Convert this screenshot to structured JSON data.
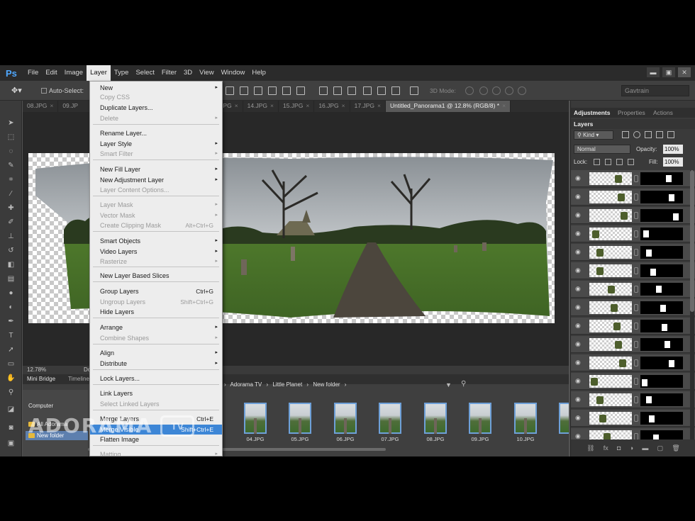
{
  "app": {
    "logo": "Ps"
  },
  "menubar": {
    "items": [
      "File",
      "Edit",
      "Image",
      "Layer",
      "Type",
      "Select",
      "Filter",
      "3D",
      "View",
      "Window",
      "Help"
    ],
    "active": "Layer"
  },
  "window_controls": {
    "minimize": "▬",
    "restore": "▣",
    "close": "✕"
  },
  "optionsbar": {
    "move_icon": "move-tool-icon",
    "auto_select_label": "Auto-Select:",
    "mode_3d_label": "3D Mode:",
    "workspace": "Gavtrain"
  },
  "doc_tabs": [
    {
      "label": "08.JPG"
    },
    {
      "label": "09.JP"
    },
    {
      "label": "13.JPG"
    },
    {
      "label": "14.JPG"
    },
    {
      "label": "15.JPG"
    },
    {
      "label": "16.JPG"
    },
    {
      "label": "17.JPG"
    },
    {
      "label": "Untitled_Panorama1 @ 12.8% (RGB/8) *"
    }
  ],
  "status": {
    "zoom": "12.78%",
    "doc_label": "Do"
  },
  "layer_menu": {
    "items": [
      {
        "label": "New",
        "disabled": false,
        "arrow": "▸"
      },
      {
        "label": "Copy CSS",
        "disabled": true
      },
      {
        "label": "Duplicate Layers...",
        "disabled": false
      },
      {
        "label": "Delete",
        "disabled": true,
        "arrow": "▸"
      },
      {
        "label": "Rename Layer...",
        "disabled": false
      },
      {
        "label": "Layer Style",
        "disabled": false,
        "arrow": "▸"
      },
      {
        "label": "Smart Filter",
        "disabled": true,
        "arrow": "▸"
      },
      {
        "label": "New Fill Layer",
        "disabled": false,
        "arrow": "▸"
      },
      {
        "label": "New Adjustment Layer",
        "disabled": false,
        "arrow": "▸"
      },
      {
        "label": "Layer Content Options...",
        "disabled": true
      },
      {
        "label": "Layer Mask",
        "disabled": true,
        "arrow": "▸"
      },
      {
        "label": "Vector Mask",
        "disabled": true,
        "arrow": "▸"
      },
      {
        "label": "Create Clipping Mask",
        "disabled": true,
        "shortcut": "Alt+Ctrl+G"
      },
      {
        "label": "Smart Objects",
        "disabled": false,
        "arrow": "▸"
      },
      {
        "label": "Video Layers",
        "disabled": false,
        "arrow": "▸"
      },
      {
        "label": "Rasterize",
        "disabled": true,
        "arrow": "▸"
      },
      {
        "label": "New Layer Based Slices",
        "disabled": false
      },
      {
        "label": "Group Layers",
        "disabled": false,
        "shortcut": "Ctrl+G"
      },
      {
        "label": "Ungroup Layers",
        "disabled": true,
        "shortcut": "Shift+Ctrl+G"
      },
      {
        "label": "Hide Layers",
        "disabled": false
      },
      {
        "label": "Arrange",
        "disabled": false,
        "arrow": "▸"
      },
      {
        "label": "Combine Shapes",
        "disabled": true,
        "arrow": "▸"
      },
      {
        "label": "Align",
        "disabled": false,
        "arrow": "▸"
      },
      {
        "label": "Distribute",
        "disabled": false,
        "arrow": "▸"
      },
      {
        "label": "Lock Layers...",
        "disabled": false
      },
      {
        "label": "Link Layers",
        "disabled": false
      },
      {
        "label": "Select Linked Layers",
        "disabled": true
      },
      {
        "label": "Merge Layers",
        "disabled": false,
        "shortcut": "Ctrl+E"
      },
      {
        "label": "Merge Visible",
        "disabled": false,
        "shortcut": "Shift+Ctrl+E",
        "highlighted": true
      },
      {
        "label": "Flatten Image",
        "disabled": false
      },
      {
        "label": "Matting",
        "disabled": true,
        "arrow": "▸"
      }
    ]
  },
  "mini_bridge": {
    "tabs": [
      "Mini Bridge",
      "Timeline"
    ],
    "nav_root": "Computer",
    "folders": [
      {
        "label": "All Adorama"
      },
      {
        "label": "New folder",
        "selected": true
      }
    ],
    "path": [
      "Adorama TV",
      "Little Planet",
      "New folder"
    ],
    "thumbs": [
      "04.JPG",
      "05.JPG",
      "06.JPG",
      "07.JPG",
      "08.JPG",
      "09.JPG",
      "10.JPG",
      "11"
    ]
  },
  "right_panel": {
    "tabs": [
      "Adjustments",
      "Properties",
      "Actions"
    ],
    "layers_title": "Layers",
    "kind": "Kind",
    "blend_mode": "Normal",
    "opacity_label": "Opacity:",
    "opacity": "100%",
    "lock_label": "Lock:",
    "fill_label": "Fill:",
    "fill": "100%",
    "layer_count": 15
  },
  "watermark": {
    "text": "ADORAMA",
    "tv": "TV"
  },
  "colors": {
    "accent": "#3d86d6",
    "menu_bg": "#ededed",
    "app_bg": "#535353"
  }
}
